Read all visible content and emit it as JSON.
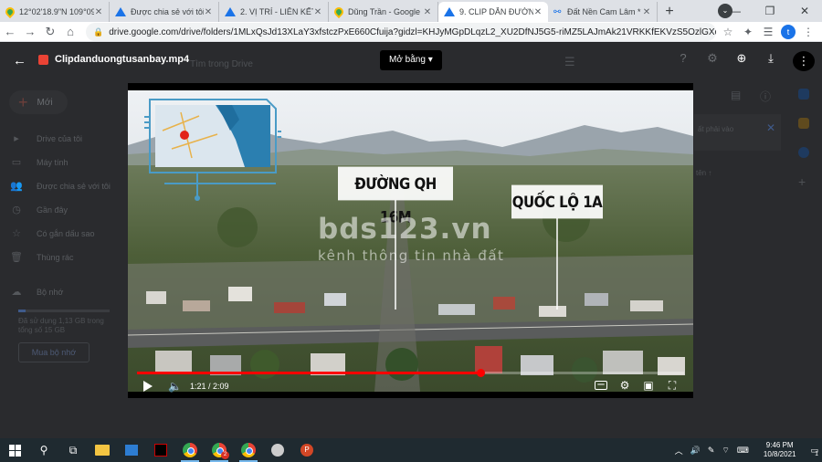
{
  "browser": {
    "tabs": [
      {
        "title": "12°02'18.9\"N 109°09'3",
        "favicon": "maps-icon"
      },
      {
        "title": "Được chia sẻ với tôi - G",
        "favicon": "drive-icon"
      },
      {
        "title": "2. VỊ TRÍ - LIÊN KẾT VÙ",
        "favicon": "drive-icon"
      },
      {
        "title": "Dũng Trần - Google M",
        "favicon": "maps-icon"
      },
      {
        "title": "9. CLIP DẪN ĐƯỜNG",
        "favicon": "drive-icon",
        "active": true
      },
      {
        "title": "Đất Nền Cam Lâm *",
        "favicon": "link-icon"
      }
    ],
    "new_tab": "+",
    "url": "drive.google.com/drive/folders/1MLxQsJd13XLaY3xfstczPxE660Cfuija?gidzl=KHJyMGpDLqzL2_XU2DfNJ5G5-riMZ5LAJmAk21VRKKfEKVzS5OzlGXq2-0H4YG966mU...",
    "profile_initial": "t"
  },
  "drive": {
    "search_placeholder": "Tìm trong Drive",
    "new_label": "Mới",
    "sidebar": [
      {
        "label": "Drive của tôi",
        "icon": "drive-icon"
      },
      {
        "label": "Máy tính",
        "icon": "computer-icon"
      },
      {
        "label": "Được chia sẻ với tôi",
        "icon": "people-icon"
      },
      {
        "label": "Gần đây",
        "icon": "clock-icon"
      },
      {
        "label": "Có gắn dấu sao",
        "icon": "star-icon"
      },
      {
        "label": "Thùng rác",
        "icon": "trash-icon"
      }
    ],
    "storage_label": "Bộ nhớ",
    "storage_text": "Đã sử dụng 1,13 GB trong tổng số 15 GB",
    "storage_fraction": 0.075,
    "buy_label": "Mua bộ nhớ",
    "notice_text": "ất phải vào",
    "sort_text": "tên ↑"
  },
  "viewer": {
    "file_name": "Clipdanduongtusanbay.mp4",
    "open_with_label": "Mở bằng",
    "video": {
      "label_road_1": "ĐƯỜNG QH 16M",
      "label_road_2": "QUỐC LỘ 1A",
      "watermark_main": "bds123.vn",
      "watermark_sub": "kênh thông tin nhà đất",
      "time_display": "1:21 / 2:09",
      "progress_fraction": 0.628
    }
  },
  "taskbar": {
    "time": "9:46 PM",
    "date": "10/8/2021",
    "chrome_badge": "2",
    "notif_count": "1"
  }
}
